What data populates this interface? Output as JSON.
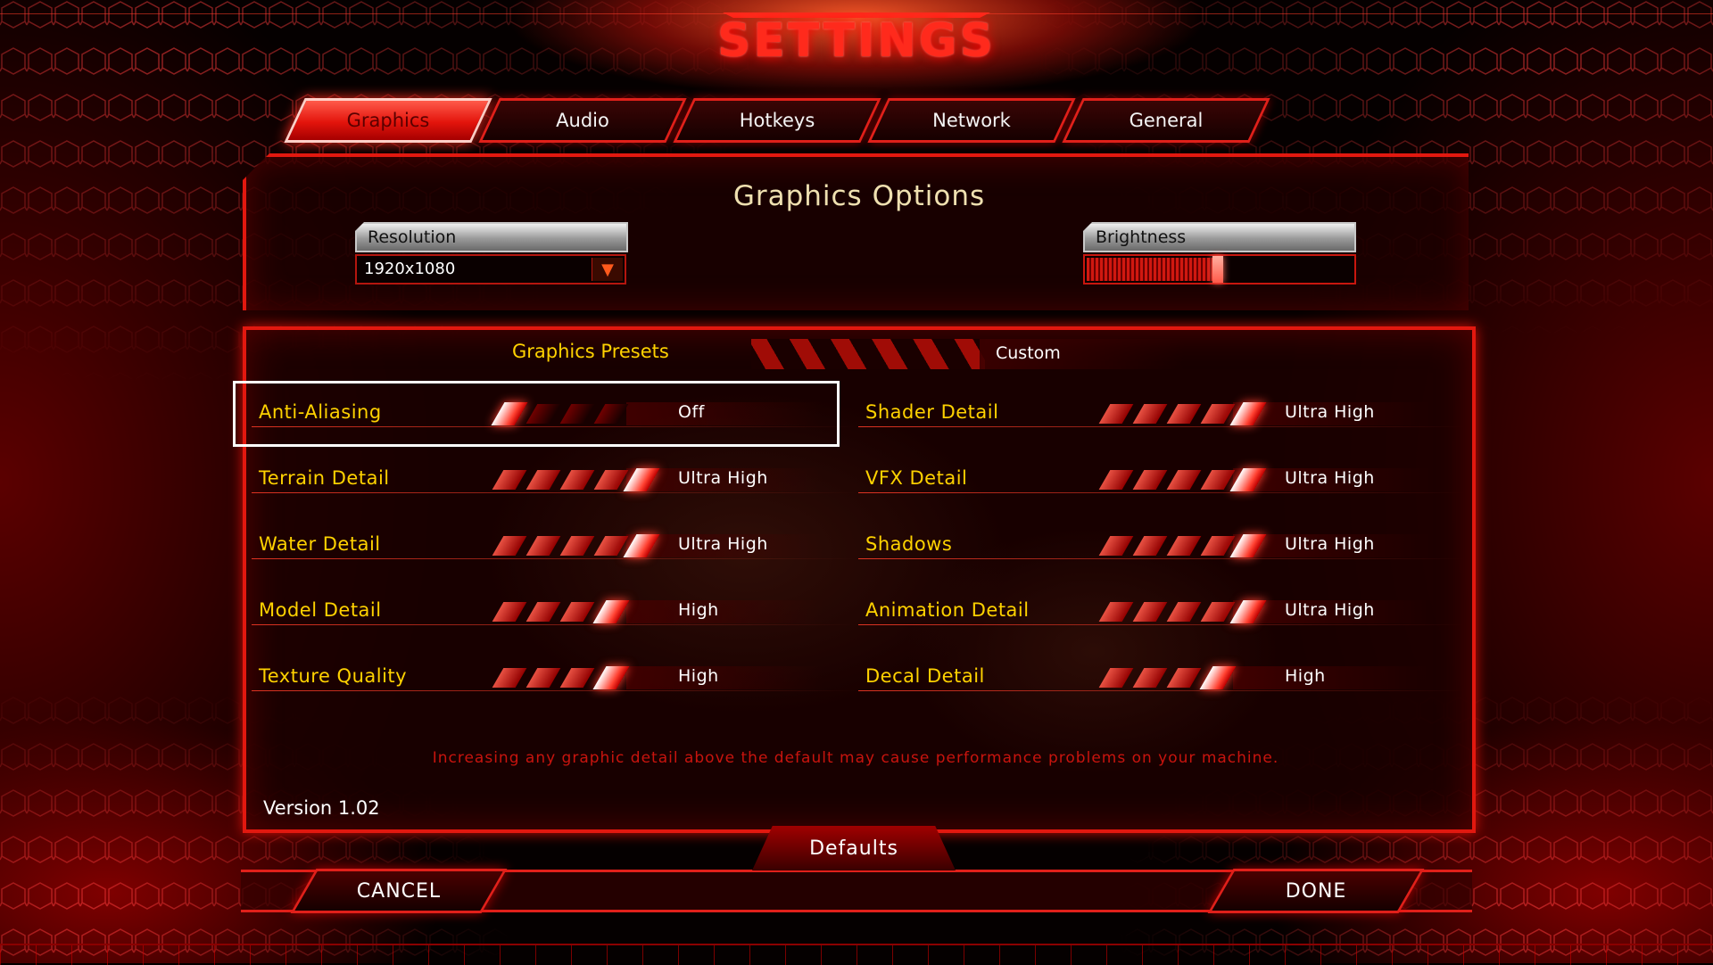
{
  "title": "SETTINGS",
  "tabs": [
    {
      "label": "Graphics",
      "active": true
    },
    {
      "label": "Audio",
      "active": false
    },
    {
      "label": "Hotkeys",
      "active": false
    },
    {
      "label": "Network",
      "active": false
    },
    {
      "label": "General",
      "active": false
    }
  ],
  "graphics_options": {
    "title": "Graphics Options",
    "resolution": {
      "label": "Resolution",
      "value": "1920x1080"
    },
    "brightness": {
      "label": "Brightness",
      "level": 0.5
    }
  },
  "presets": {
    "label": "Graphics Presets",
    "value": "Custom"
  },
  "options_left": [
    {
      "label": "Anti-Aliasing",
      "value": "Off",
      "level": 0,
      "steps": 4
    },
    {
      "label": "Terrain Detail",
      "value": "Ultra High",
      "level": 4,
      "steps": 4
    },
    {
      "label": "Water Detail",
      "value": "Ultra High",
      "level": 4,
      "steps": 4
    },
    {
      "label": "Model Detail",
      "value": "High",
      "level": 3,
      "steps": 4
    },
    {
      "label": "Texture Quality",
      "value": "High",
      "level": 3,
      "steps": 4
    }
  ],
  "options_right": [
    {
      "label": "Shader Detail",
      "value": "Ultra High",
      "level": 4,
      "steps": 4
    },
    {
      "label": "VFX Detail",
      "value": "Ultra High",
      "level": 4,
      "steps": 4
    },
    {
      "label": "Shadows",
      "value": "Ultra High",
      "level": 4,
      "steps": 4
    },
    {
      "label": "Animation Detail",
      "value": "Ultra High",
      "level": 4,
      "steps": 4
    },
    {
      "label": "Decal Detail",
      "value": "High",
      "level": 3,
      "steps": 4
    }
  ],
  "warning": "Increasing any graphic detail above the default may cause performance problems on your machine.",
  "version": "Version 1.02",
  "buttons": {
    "defaults": "Defaults",
    "cancel": "CANCEL",
    "done": "DONE"
  },
  "colors": {
    "accent": "#e2180f",
    "label_yellow": "#ffd200",
    "title_red": "#ff2a1c"
  }
}
